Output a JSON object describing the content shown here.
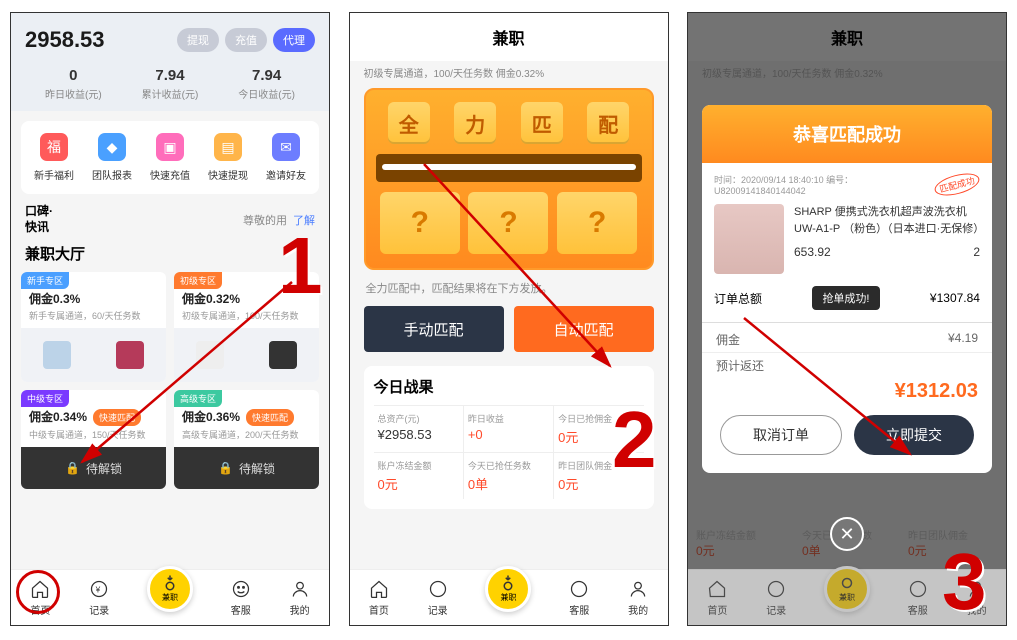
{
  "annotations": {
    "step1": "1",
    "step2": "2",
    "step3": "3"
  },
  "nav": {
    "home": "首页",
    "record": "记录",
    "center": "兼职",
    "service": "客服",
    "mine": "我的"
  },
  "s1": {
    "balance": "2958.53",
    "pills": {
      "withdraw": "提现",
      "deposit": "充值",
      "agent": "代理"
    },
    "stats": [
      {
        "v": "0",
        "l": "昨日收益(元)"
      },
      {
        "v": "7.94",
        "l": "累计收益(元)"
      },
      {
        "v": "7.94",
        "l": "今日收益(元)"
      }
    ],
    "menu": [
      {
        "t": "新手福利",
        "c": "#ff5a5a"
      },
      {
        "t": "团队报表",
        "c": "#4aa0ff"
      },
      {
        "t": "快速充值",
        "c": "#ff6dbb"
      },
      {
        "t": "快速提现",
        "c": "#ffb54a"
      },
      {
        "t": "邀请好友",
        "c": "#6d7dff"
      }
    ],
    "brand": {
      "line1": "口碑·",
      "line2": "快讯",
      "right": "尊敬的用",
      "link": "了解"
    },
    "hall": "兼职大厅",
    "cards": [
      {
        "tag": "新手专区",
        "tc": "n",
        "comm": "佣金0.3%",
        "desc": "新手专属通道，60/天任务数"
      },
      {
        "tag": "初级专区",
        "tc": "i",
        "comm": "佣金0.32%",
        "desc": "初级专属通道，100/天任务数"
      },
      {
        "tag": "中级专区",
        "tc": "m",
        "comm": "佣金0.34%",
        "desc": "中级专属通道，150/天任务数",
        "fast": "快速匹配"
      },
      {
        "tag": "高级专区",
        "tc": "h",
        "comm": "佣金0.36%",
        "desc": "高级专属通道，200/天任务数",
        "fast": "快速匹配"
      }
    ],
    "lock": "待解锁"
  },
  "s2": {
    "title": "兼职",
    "sub": "初级专属通道，100/天任务数 佣金0.32%",
    "hero": {
      "chars": [
        "全",
        "力",
        "匹",
        "配"
      ],
      "q": "?"
    },
    "note": "全力匹配中，匹配结果将在下方发放。",
    "btn_manual": "手动匹配",
    "btn_auto": "自动匹配",
    "result_title": "今日战果",
    "row1": [
      {
        "l": "总资产(元)",
        "v": "¥2958.53"
      },
      {
        "l": "昨日收益",
        "v": "+0",
        "red": true
      },
      {
        "l": "今日已抢佣金",
        "v": "0元",
        "red": true
      }
    ],
    "row2": [
      {
        "l": "账户冻结金额",
        "v": "0元",
        "red": true
      },
      {
        "l": "今天已抢任务数",
        "v": "0单",
        "red": true
      },
      {
        "l": "昨日团队佣金",
        "v": "0元",
        "red": true
      }
    ]
  },
  "s3": {
    "title": "兼职",
    "sub": "初级专属通道，100/天任务数 佣金0.32%",
    "modal_title": "恭喜匹配成功",
    "meta_time": "时间：2020/09/14 18:40:10  编号：",
    "meta_id": "U82009141840144042",
    "stamp": "匹配成功",
    "product": "SHARP 便携式洗衣机超声波洗衣机 UW-A1-P （粉色）（日本进口·无保修）",
    "price": "653.92",
    "qty": "2",
    "total_l": "订单总额",
    "total_v": "¥1307.84",
    "grab": "抢单成功!",
    "comm_l": "佣金",
    "comm_v": "¥4.19",
    "ret_l": "预计返还",
    "ret_v": "¥1312.03",
    "cancel": "取消订单",
    "submit": "立即提交",
    "under": [
      {
        "l": "账户冻结金额",
        "v": "0元"
      },
      {
        "l": "今天已抢任务数",
        "v": "0单"
      },
      {
        "l": "昨日团队佣金",
        "v": "0元"
      }
    ]
  }
}
